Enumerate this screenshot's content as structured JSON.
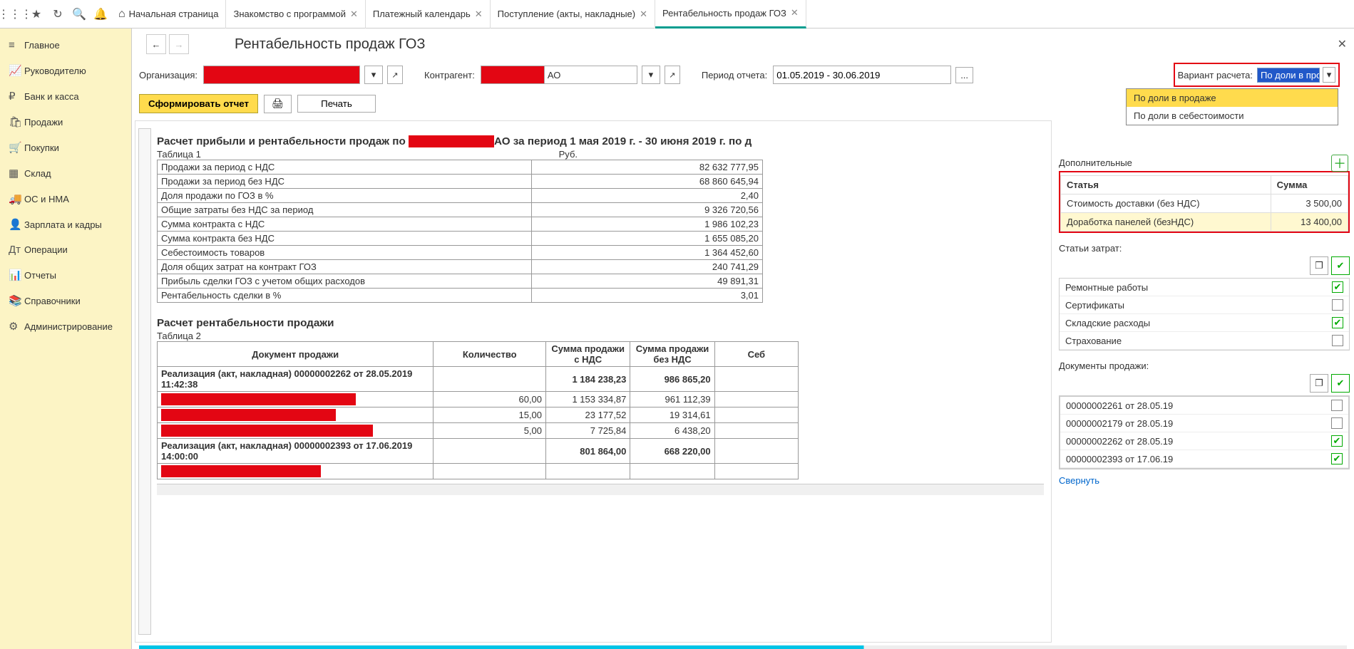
{
  "toolbar_icons": [
    "apps",
    "star",
    "history",
    "search",
    "bell"
  ],
  "tabs": [
    {
      "label": "Начальная страница",
      "home": true
    },
    {
      "label": "Знакомство с программой"
    },
    {
      "label": "Платежный календарь"
    },
    {
      "label": "Поступление (акты, накладные)"
    },
    {
      "label": "Рентабельность продаж ГОЗ",
      "active": true
    }
  ],
  "sidebar": [
    {
      "icon": "≡",
      "label": "Главное"
    },
    {
      "icon": "📈",
      "label": "Руководителю"
    },
    {
      "icon": "₽",
      "label": "Банк и касса"
    },
    {
      "icon": "🛍",
      "label": "Продажи"
    },
    {
      "icon": "🛒",
      "label": "Покупки"
    },
    {
      "icon": "▦",
      "label": "Склад"
    },
    {
      "icon": "🚚",
      "label": "ОС и НМА"
    },
    {
      "icon": "👤",
      "label": "Зарплата и кадры"
    },
    {
      "icon": "Дт",
      "label": "Операции"
    },
    {
      "icon": "📊",
      "label": "Отчеты"
    },
    {
      "icon": "📚",
      "label": "Справочники"
    },
    {
      "icon": "⚙",
      "label": "Администрирование"
    }
  ],
  "page_title": "Рентабельность продаж ГОЗ",
  "filters": {
    "org_label": "Организация:",
    "contr_label": "Контрагент:",
    "contr_suffix": "АО",
    "period_label": "Период отчета:",
    "period_value": "01.05.2019 - 30.06.2019",
    "variant_label": "Вариант расчета:",
    "variant_selected": "По доли в про",
    "variant_opts": [
      "По доли в продаже",
      "По доли в себестоимости"
    ]
  },
  "buttons": {
    "form": "Сформировать отчет",
    "print": "Печать"
  },
  "report": {
    "title_a": "Расчет прибыли и рентабельности продаж по ",
    "title_b": "АО за период 1 мая 2019 г. - 30 июня 2019 г. по д",
    "tbl1_caption": "Таблица 1",
    "tbl1_unit": "Руб.",
    "tbl1_rows": [
      {
        "name": "Продажи за период с НДС",
        "val": "82 632 777,95"
      },
      {
        "name": "Продажи за период без НДС",
        "val": "68 860 645,94"
      },
      {
        "name": "Доля продажи по ГОЗ в %",
        "val": "2,40"
      },
      {
        "name": "Общие затраты без НДС за период",
        "val": "9 326 720,56"
      },
      {
        "name": "Сумма контракта с НДС",
        "val": "1 986 102,23"
      },
      {
        "name": "Сумма контракта без НДС",
        "val": "1 655 085,20"
      },
      {
        "name": "Себестоимость товаров",
        "val": "1 364 452,60"
      },
      {
        "name": "Доля общих затрат на контракт ГОЗ",
        "val": "240 741,29"
      },
      {
        "name": "Прибыль сделки ГОЗ с учетом общих расходов",
        "val": "49 891,31"
      },
      {
        "name": "Рентабельность сделки в %",
        "val": "3,01"
      }
    ],
    "tbl2_title": "Расчет рентабельности продажи",
    "tbl2_caption": "Таблица 2",
    "tbl2_headers": [
      "Документ продажи",
      "Количество",
      "Сумма продажи с НДС",
      "Сумма продажи без НДС",
      "Себ"
    ],
    "tbl2_rows": [
      {
        "doc": "Реализация (акт, накладная) 00000002262 от 28.05.2019 11:42:38",
        "qty": "",
        "sum_nds": "1 184 238,23",
        "sum_no": "986 865,20",
        "bold": true
      },
      {
        "doc": "red",
        "qty": "60,00",
        "sum_nds": "1 153 334,87",
        "sum_no": "961 112,39"
      },
      {
        "doc": "red",
        "qty": "15,00",
        "sum_nds": "23 177,52",
        "sum_no": "19 314,61"
      },
      {
        "doc": "red",
        "qty": "5,00",
        "sum_nds": "7 725,84",
        "sum_no": "6 438,20"
      },
      {
        "doc": "Реализация (акт, накладная) 00000002393 от 17.06.2019 14:00:00",
        "qty": "",
        "sum_nds": "801 864,00",
        "sum_no": "668 220,00",
        "bold": true
      },
      {
        "doc": "red",
        "qty": "",
        "sum_nds": "",
        "sum_no": ""
      }
    ]
  },
  "side": {
    "additional_label": "Дополнительные",
    "articles_header": [
      "Статья",
      "Сумма"
    ],
    "articles": [
      {
        "name": "Стоимость доставки (без НДС)",
        "val": "3 500,00"
      },
      {
        "name": "Доработка панелей (безНДС)",
        "val": "13 400,00",
        "hl": true
      }
    ],
    "costs_label": "Статьи затрат:",
    "costs": [
      {
        "name": "Ремонтные работы",
        "on": true
      },
      {
        "name": "Сертификаты",
        "on": false
      },
      {
        "name": "Складские расходы",
        "on": true
      },
      {
        "name": "Страхование",
        "on": false
      }
    ],
    "docs_label": "Документы продажи:",
    "docs": [
      {
        "name": "00000002261 от 28.05.19",
        "on": false
      },
      {
        "name": "00000002179 от 28.05.19",
        "on": false
      },
      {
        "name": "00000002262 от 28.05.19",
        "on": true
      },
      {
        "name": "00000002393 от 17.06.19",
        "on": true
      }
    ]
  },
  "footer": {
    "collapse": "Свернуть"
  }
}
